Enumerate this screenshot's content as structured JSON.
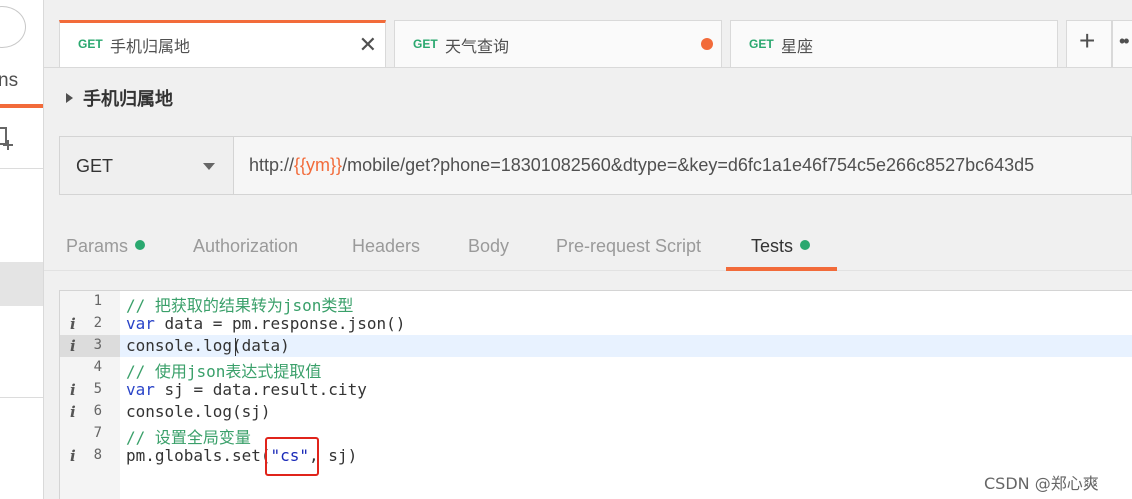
{
  "sidebar": {
    "partial_label": "ns"
  },
  "tabs": [
    {
      "method": "GET",
      "name": "手机归属地",
      "active": true,
      "indicator": "close-icon"
    },
    {
      "method": "GET",
      "name": "天气查询",
      "active": false,
      "indicator": "unsaved-dot"
    },
    {
      "method": "GET",
      "name": "星座",
      "active": false,
      "indicator": ""
    }
  ],
  "tab_actions": {
    "new_tab_label": "+",
    "more_label": "••"
  },
  "breadcrumb": {
    "title": "手机归属地"
  },
  "request": {
    "method": "GET",
    "url_prefix": "http://",
    "url_variable": "{{ym}}",
    "url_suffix": "/mobile/get?phone=18301082560&dtype=&key=d6fc1a1e46f754c5e266c8527bc643d5"
  },
  "request_tabs": [
    {
      "label": "Params",
      "has_dot": true
    },
    {
      "label": "Authorization",
      "has_dot": false
    },
    {
      "label": "Headers",
      "has_dot": false
    },
    {
      "label": "Body",
      "has_dot": false
    },
    {
      "label": "Pre-request Script",
      "has_dot": false
    },
    {
      "label": "Tests",
      "has_dot": true,
      "active": true
    }
  ],
  "editor": {
    "lines": [
      {
        "num": "1",
        "info": false,
        "text": "// 把获取的结果转为json类型"
      },
      {
        "num": "2",
        "info": true,
        "kw": "var",
        "text": " data = pm.response.json()"
      },
      {
        "num": "3",
        "info": true,
        "text": "console.log(data)",
        "highlighted": true
      },
      {
        "num": "4",
        "info": false,
        "text": "// 使用json表达式提取值"
      },
      {
        "num": "5",
        "info": true,
        "kw": "var",
        "text": " sj = data.result.city"
      },
      {
        "num": "6",
        "info": true,
        "text": "console.log(sj)"
      },
      {
        "num": "7",
        "info": false,
        "text": "// 设置全局变量"
      },
      {
        "num": "8",
        "info": true,
        "before": "pm.globals.set(",
        "string": "\"cs\"",
        "after": ", sj)"
      }
    ]
  },
  "colors": {
    "accent": "#f26b3a",
    "method_green": "#2aa86f",
    "comment_green": "#3aa06a",
    "keyword_blue": "#2a44c8",
    "annotation_red": "#e0241b"
  },
  "watermark": "CSDN @郑心爽"
}
